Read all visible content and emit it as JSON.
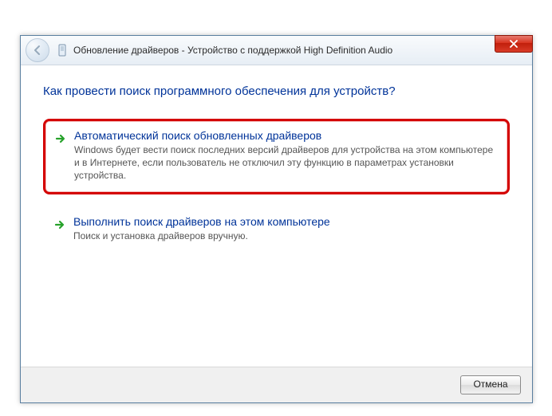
{
  "titlebar": {
    "title": "Обновление драйверов - Устройство с поддержкой High Definition Audio"
  },
  "heading": "Как провести поиск программного обеспечения для устройств?",
  "options": {
    "auto": {
      "title": "Автоматический поиск обновленных драйверов",
      "desc": "Windows будет вести поиск последних версий драйверов для устройства на этом компьютере и в Интернете, если пользователь не отключил эту функцию в параметрах установки устройства."
    },
    "manual": {
      "title": "Выполнить поиск драйверов на этом компьютере",
      "desc": "Поиск и установка драйверов вручную."
    }
  },
  "footer": {
    "cancel": "Отмена"
  }
}
